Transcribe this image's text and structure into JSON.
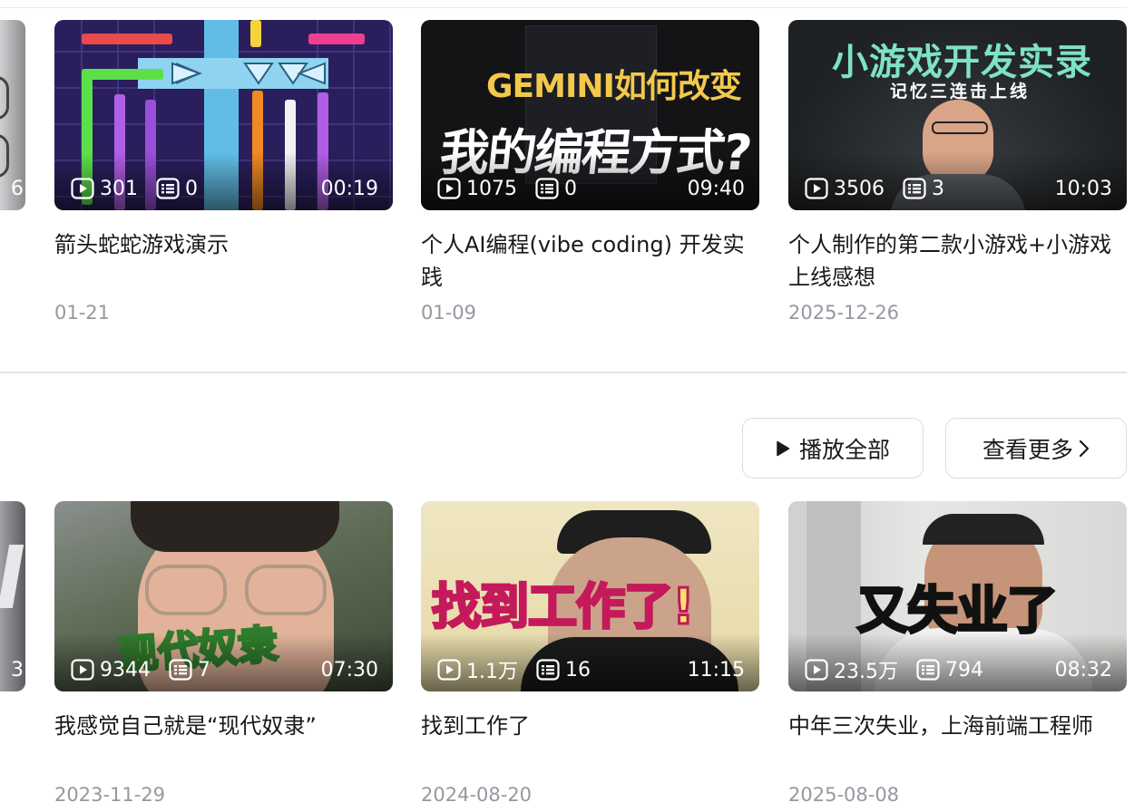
{
  "colors": {
    "title": "#18191c",
    "meta": "#9499a0",
    "divider": "#e3e5e7",
    "overlay_text": "#ffffff"
  },
  "icons": {
    "views": "play-count-icon",
    "danmaku": "danmaku-count-icon",
    "play_all": "play-icon",
    "more": "chevron-right-icon"
  },
  "row1": {
    "partial_card": {
      "count": "6"
    },
    "videos": [
      {
        "views": "301",
        "danmaku": "0",
        "duration": "00:19",
        "title": "箭头蛇蛇游戏演示",
        "date": "01-21"
      },
      {
        "views": "1075",
        "danmaku": "0",
        "duration": "09:40",
        "title": "个人AI编程(vibe coding) 开发实践",
        "date": "01-09",
        "thumb_text": {
          "line1": "GEMINI如何改变",
          "line2": "我的编程方式?"
        }
      },
      {
        "views": "3506",
        "danmaku": "3",
        "duration": "10:03",
        "title": "个人制作的第二款小游戏+小游戏上线感想",
        "date": "2025-12-26",
        "thumb_text": {
          "line1": "小游戏开发实录",
          "line2": "记忆三连击上线"
        }
      }
    ]
  },
  "actions": {
    "play_all": "播放全部",
    "view_more": "查看更多"
  },
  "row2": {
    "partial_card": {
      "count": "3"
    },
    "videos": [
      {
        "views": "9344",
        "danmaku": "7",
        "duration": "07:30",
        "title": "我感觉自己就是“现代奴隶”",
        "date": "2023-11-29",
        "thumb_text": {
          "line1": "现代奴隶"
        }
      },
      {
        "views": "1.1万",
        "danmaku": "16",
        "duration": "11:15",
        "title": "找到工作了",
        "date": "2024-08-20",
        "thumb_text": {
          "line1": "找到工作了!"
        }
      },
      {
        "views": "23.5万",
        "danmaku": "794",
        "duration": "08:32",
        "title": "中年三次失业，上海前端工程师",
        "date": "2025-08-08",
        "thumb_text": {
          "line1": "又失业了"
        }
      }
    ]
  }
}
